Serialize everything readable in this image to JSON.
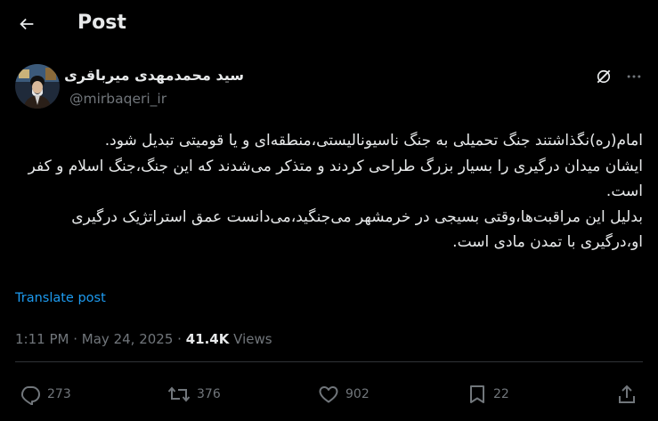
{
  "header": {
    "title": "Post"
  },
  "author": {
    "name": "سید محمدمهدی میرباقری",
    "handle": "@mirbaqeri_ir"
  },
  "tweet": {
    "paragraphs": [
      "امام(ره)نگذاشتند جنگ تحمیلی به جنگ ناسیونالیستی،منطقه‌ای و یا قومیتی تبدیل شود.",
      "ایشان میدان درگیری را بسیار بزرگ طراحی کردند و متذکر می‌شدند که این جنگ،جنگ اسلام و کفر است.",
      "بدلیل این مراقبت‌ها،وقتی بسیجی در خرمشهر می‌جنگید،می‌دانست عمق استراتژیک درگیری او،درگیری با تمدن مادی است."
    ],
    "translate_label": "Translate post"
  },
  "meta": {
    "time": "1:11 PM",
    "separator": "·",
    "date": "May 24, 2025",
    "views_count": "41.4K",
    "views_label": "Views"
  },
  "actions": {
    "replies": "273",
    "reposts": "376",
    "likes": "902",
    "bookmarks": "22"
  },
  "icons": {
    "back": "arrow-left-icon",
    "grok": "grok-icon",
    "more": "more-horizontal-icon",
    "reply": "reply-icon",
    "repost": "repost-icon",
    "like": "heart-icon",
    "bookmark": "bookmark-icon",
    "share": "share-icon"
  },
  "colors": {
    "background": "#000000",
    "text_primary": "#e7e9ea",
    "text_secondary": "#71767b",
    "link": "#1d9bf0",
    "divider": "#2f3336"
  }
}
